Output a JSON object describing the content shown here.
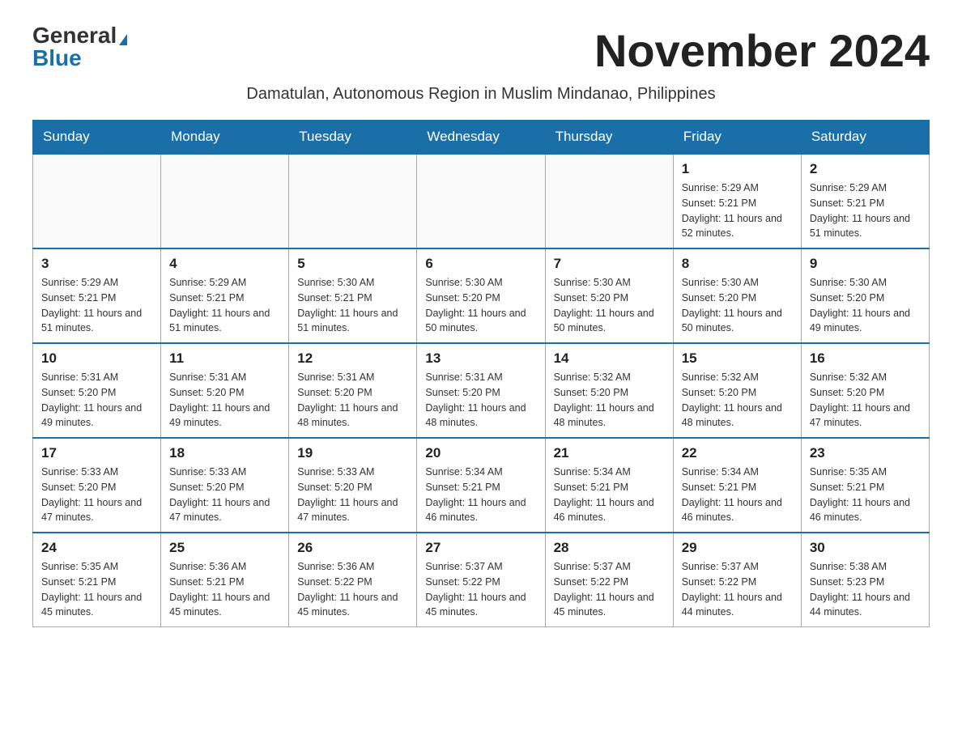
{
  "logo": {
    "general": "General",
    "blue": "Blue"
  },
  "header": {
    "month_year": "November 2024",
    "subtitle": "Damatulan, Autonomous Region in Muslim Mindanao, Philippines"
  },
  "days_of_week": [
    "Sunday",
    "Monday",
    "Tuesday",
    "Wednesday",
    "Thursday",
    "Friday",
    "Saturday"
  ],
  "weeks": [
    [
      {
        "day": "",
        "sunrise": "",
        "sunset": "",
        "daylight": ""
      },
      {
        "day": "",
        "sunrise": "",
        "sunset": "",
        "daylight": ""
      },
      {
        "day": "",
        "sunrise": "",
        "sunset": "",
        "daylight": ""
      },
      {
        "day": "",
        "sunrise": "",
        "sunset": "",
        "daylight": ""
      },
      {
        "day": "",
        "sunrise": "",
        "sunset": "",
        "daylight": ""
      },
      {
        "day": "1",
        "sunrise": "Sunrise: 5:29 AM",
        "sunset": "Sunset: 5:21 PM",
        "daylight": "Daylight: 11 hours and 52 minutes."
      },
      {
        "day": "2",
        "sunrise": "Sunrise: 5:29 AM",
        "sunset": "Sunset: 5:21 PM",
        "daylight": "Daylight: 11 hours and 51 minutes."
      }
    ],
    [
      {
        "day": "3",
        "sunrise": "Sunrise: 5:29 AM",
        "sunset": "Sunset: 5:21 PM",
        "daylight": "Daylight: 11 hours and 51 minutes."
      },
      {
        "day": "4",
        "sunrise": "Sunrise: 5:29 AM",
        "sunset": "Sunset: 5:21 PM",
        "daylight": "Daylight: 11 hours and 51 minutes."
      },
      {
        "day": "5",
        "sunrise": "Sunrise: 5:30 AM",
        "sunset": "Sunset: 5:21 PM",
        "daylight": "Daylight: 11 hours and 51 minutes."
      },
      {
        "day": "6",
        "sunrise": "Sunrise: 5:30 AM",
        "sunset": "Sunset: 5:20 PM",
        "daylight": "Daylight: 11 hours and 50 minutes."
      },
      {
        "day": "7",
        "sunrise": "Sunrise: 5:30 AM",
        "sunset": "Sunset: 5:20 PM",
        "daylight": "Daylight: 11 hours and 50 minutes."
      },
      {
        "day": "8",
        "sunrise": "Sunrise: 5:30 AM",
        "sunset": "Sunset: 5:20 PM",
        "daylight": "Daylight: 11 hours and 50 minutes."
      },
      {
        "day": "9",
        "sunrise": "Sunrise: 5:30 AM",
        "sunset": "Sunset: 5:20 PM",
        "daylight": "Daylight: 11 hours and 49 minutes."
      }
    ],
    [
      {
        "day": "10",
        "sunrise": "Sunrise: 5:31 AM",
        "sunset": "Sunset: 5:20 PM",
        "daylight": "Daylight: 11 hours and 49 minutes."
      },
      {
        "day": "11",
        "sunrise": "Sunrise: 5:31 AM",
        "sunset": "Sunset: 5:20 PM",
        "daylight": "Daylight: 11 hours and 49 minutes."
      },
      {
        "day": "12",
        "sunrise": "Sunrise: 5:31 AM",
        "sunset": "Sunset: 5:20 PM",
        "daylight": "Daylight: 11 hours and 48 minutes."
      },
      {
        "day": "13",
        "sunrise": "Sunrise: 5:31 AM",
        "sunset": "Sunset: 5:20 PM",
        "daylight": "Daylight: 11 hours and 48 minutes."
      },
      {
        "day": "14",
        "sunrise": "Sunrise: 5:32 AM",
        "sunset": "Sunset: 5:20 PM",
        "daylight": "Daylight: 11 hours and 48 minutes."
      },
      {
        "day": "15",
        "sunrise": "Sunrise: 5:32 AM",
        "sunset": "Sunset: 5:20 PM",
        "daylight": "Daylight: 11 hours and 48 minutes."
      },
      {
        "day": "16",
        "sunrise": "Sunrise: 5:32 AM",
        "sunset": "Sunset: 5:20 PM",
        "daylight": "Daylight: 11 hours and 47 minutes."
      }
    ],
    [
      {
        "day": "17",
        "sunrise": "Sunrise: 5:33 AM",
        "sunset": "Sunset: 5:20 PM",
        "daylight": "Daylight: 11 hours and 47 minutes."
      },
      {
        "day": "18",
        "sunrise": "Sunrise: 5:33 AM",
        "sunset": "Sunset: 5:20 PM",
        "daylight": "Daylight: 11 hours and 47 minutes."
      },
      {
        "day": "19",
        "sunrise": "Sunrise: 5:33 AM",
        "sunset": "Sunset: 5:20 PM",
        "daylight": "Daylight: 11 hours and 47 minutes."
      },
      {
        "day": "20",
        "sunrise": "Sunrise: 5:34 AM",
        "sunset": "Sunset: 5:21 PM",
        "daylight": "Daylight: 11 hours and 46 minutes."
      },
      {
        "day": "21",
        "sunrise": "Sunrise: 5:34 AM",
        "sunset": "Sunset: 5:21 PM",
        "daylight": "Daylight: 11 hours and 46 minutes."
      },
      {
        "day": "22",
        "sunrise": "Sunrise: 5:34 AM",
        "sunset": "Sunset: 5:21 PM",
        "daylight": "Daylight: 11 hours and 46 minutes."
      },
      {
        "day": "23",
        "sunrise": "Sunrise: 5:35 AM",
        "sunset": "Sunset: 5:21 PM",
        "daylight": "Daylight: 11 hours and 46 minutes."
      }
    ],
    [
      {
        "day": "24",
        "sunrise": "Sunrise: 5:35 AM",
        "sunset": "Sunset: 5:21 PM",
        "daylight": "Daylight: 11 hours and 45 minutes."
      },
      {
        "day": "25",
        "sunrise": "Sunrise: 5:36 AM",
        "sunset": "Sunset: 5:21 PM",
        "daylight": "Daylight: 11 hours and 45 minutes."
      },
      {
        "day": "26",
        "sunrise": "Sunrise: 5:36 AM",
        "sunset": "Sunset: 5:22 PM",
        "daylight": "Daylight: 11 hours and 45 minutes."
      },
      {
        "day": "27",
        "sunrise": "Sunrise: 5:37 AM",
        "sunset": "Sunset: 5:22 PM",
        "daylight": "Daylight: 11 hours and 45 minutes."
      },
      {
        "day": "28",
        "sunrise": "Sunrise: 5:37 AM",
        "sunset": "Sunset: 5:22 PM",
        "daylight": "Daylight: 11 hours and 45 minutes."
      },
      {
        "day": "29",
        "sunrise": "Sunrise: 5:37 AM",
        "sunset": "Sunset: 5:22 PM",
        "daylight": "Daylight: 11 hours and 44 minutes."
      },
      {
        "day": "30",
        "sunrise": "Sunrise: 5:38 AM",
        "sunset": "Sunset: 5:23 PM",
        "daylight": "Daylight: 11 hours and 44 minutes."
      }
    ]
  ]
}
